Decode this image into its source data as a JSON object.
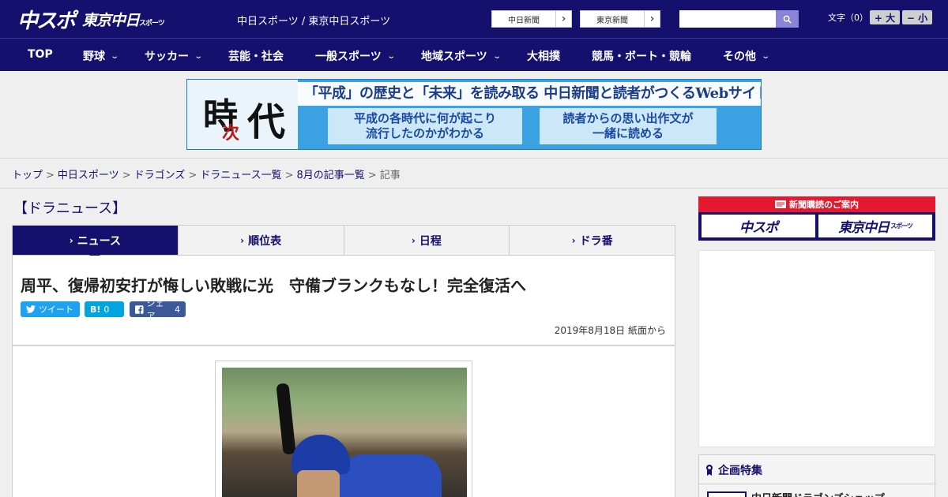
{
  "header": {
    "logo_main": "中スポ",
    "logo_tokyo": "東京中日",
    "logo_tokyo_small": "スポーツ",
    "site_names": "中日スポーツ / 東京中日スポーツ",
    "paper_buttons": [
      "中日新聞",
      "東京新聞"
    ],
    "search_placeholder": "",
    "font_size_label": "文字（0）",
    "font_larger": "+ 大",
    "font_smaller": "− 小"
  },
  "nav": {
    "items": [
      {
        "label": "TOP"
      },
      {
        "label": "野球"
      },
      {
        "label": "サッカー"
      },
      {
        "label": "芸能・社会"
      },
      {
        "label": "一般スポーツ"
      },
      {
        "label": "地域スポーツ"
      },
      {
        "label": "大相撲"
      },
      {
        "label": "競馬・ボート・競輪"
      },
      {
        "label": "その他"
      }
    ]
  },
  "banner": {
    "logo_char1": "時",
    "logo_char2": "次",
    "logo_char3": "代",
    "headline": "「平成」の歴史と「未来」を読み取る 中日新聞と読者がつくるWebサイト",
    "sub_left_1": "平成の各時代に何が起こり",
    "sub_left_2": "流行したのかがわかる",
    "sub_right_1": "読者からの思い出作文が",
    "sub_right_2": "一緒に読める"
  },
  "breadcrumb": {
    "items": [
      "トップ",
      "中日スポーツ",
      "ドラゴンズ",
      "ドラニュース一覧",
      "8月の記事一覧"
    ],
    "current": "記事"
  },
  "main": {
    "section_title": "【ドラニュース】",
    "tabs": [
      {
        "label": "ニュース"
      },
      {
        "label": "順位表"
      },
      {
        "label": "日程"
      },
      {
        "label": "ドラ番"
      }
    ],
    "article": {
      "title": "周平、復帰初安打が悔しい敗戦に光　守備ブランクもなし！完全復活へ",
      "tweet_label": "ツイート",
      "hatena_label": "B!",
      "hatena_count": "0",
      "share_label": "シェア",
      "share_count": "4",
      "date": "2019年8月18日 紙面から"
    }
  },
  "sidebar": {
    "subscription_header": "新聞購読のご案内",
    "sub_logo_1": "中スポ",
    "sub_logo_2": "東京中日",
    "sub_logo_2_small": "スポーツ",
    "feature_title": "企画特集",
    "feature_item": "中日新聞ドラゴンズショップ"
  },
  "colors": {
    "brand_navy": "#15106e",
    "accent_red": "#e4182e",
    "twitter": "#1da1f2",
    "facebook": "#3b5998",
    "hatena": "#00a4de"
  }
}
